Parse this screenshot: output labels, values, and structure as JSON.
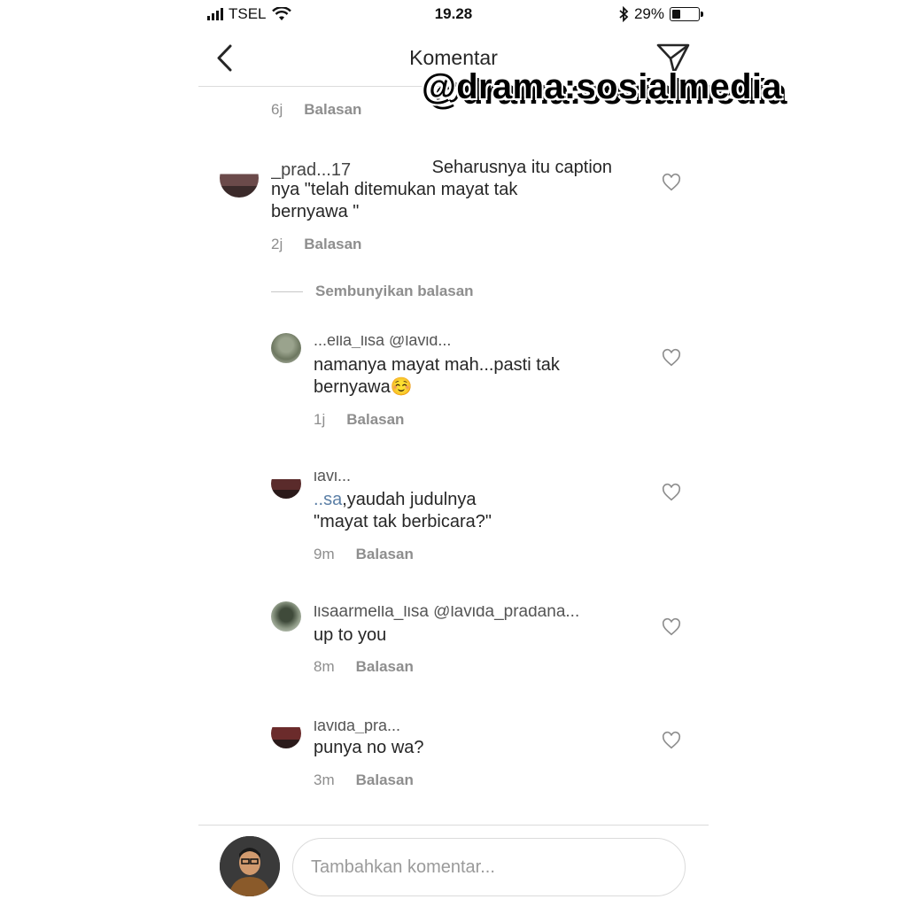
{
  "status_bar": {
    "carrier": "TSEL",
    "time": "19.28",
    "battery": "29%",
    "battery_level": 0.29
  },
  "nav": {
    "title": "Komentar",
    "back_icon": "chevron-left-icon",
    "share_icon": "send-icon"
  },
  "watermark": "@drama:sosialmedia",
  "comments": [
    {
      "time": "6j",
      "reply_label": "Balasan"
    },
    {
      "username_partial": "_prad...17",
      "line1": "Seharusnya itu caption",
      "line2": "nya \"telah ditemukan mayat tak",
      "line3": "bernyawa \"",
      "time": "2j",
      "reply_label": "Balasan"
    }
  ],
  "hide_replies_label": "Sembunyikan balasan",
  "replies": [
    {
      "username_partial": "...ella_lisa @lavid...",
      "line1": "namanya mayat mah...pasti tak",
      "line2": "bernyawa☺️",
      "time": "1j",
      "reply_label": "Balasan"
    },
    {
      "username_partial": "lavi...",
      "line1_prefix": "..sa",
      "line1": ",yaudah  judulnya",
      "line2": "\"mayat tak berbicara?\"",
      "time": "9m",
      "reply_label": "Balasan"
    },
    {
      "username_partial": "lisaarmella_lisa @lavida_pradana...",
      "line1": "up to you",
      "time": "8m",
      "reply_label": "Balasan"
    },
    {
      "username_partial": "lavida_pra...",
      "line1": "punya no wa?",
      "time": "3m",
      "reply_label": "Balasan"
    }
  ],
  "composer": {
    "placeholder": "Tambahkan komentar..."
  }
}
